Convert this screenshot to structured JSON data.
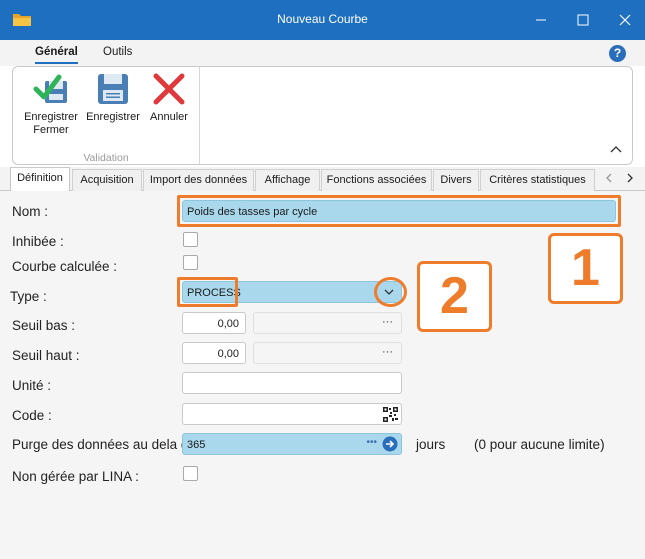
{
  "window": {
    "title": "Nouveau Courbe"
  },
  "ribbon": {
    "tabs": [
      "Général",
      "Outils"
    ],
    "buttons": {
      "save_close": [
        "Enregistrer",
        "Fermer"
      ],
      "save": "Enregistrer",
      "cancel": "Annuler"
    },
    "group_label": "Validation"
  },
  "tabs": [
    "Définition",
    "Acquisition",
    "Import des données",
    "Affichage",
    "Fonctions associées",
    "Divers",
    "Critères statistiques"
  ],
  "form": {
    "nom": {
      "label": "Nom :",
      "value": "Poids des tasses par cycle"
    },
    "inhibee": {
      "label": "Inhibée :",
      "checked": false
    },
    "courbe_calculee": {
      "label": "Courbe calculée :",
      "checked": false
    },
    "type": {
      "label": "Type :",
      "value": "PROCESS"
    },
    "seuil_bas": {
      "label": "Seuil bas :",
      "value": "0,00",
      "picker": "···"
    },
    "seuil_haut": {
      "label": "Seuil haut :",
      "value": "0,00",
      "picker": "···"
    },
    "unite": {
      "label": "Unité :",
      "value": ""
    },
    "code": {
      "label": "Code :",
      "value": ""
    },
    "purge": {
      "label": "Purge des données au dela de",
      "value": "365",
      "dots": "•••",
      "unit": "jours",
      "hint": "(0 pour aucune limite)"
    },
    "non_geree": {
      "label": "Non gérée par LINA :",
      "checked": false
    }
  },
  "annotations": {
    "callout1": "1",
    "callout2": "2"
  },
  "colors": {
    "titlebar": "#1e6fbf",
    "highlight": "#ee7c2b",
    "selected_field": "#a9d8ec"
  }
}
